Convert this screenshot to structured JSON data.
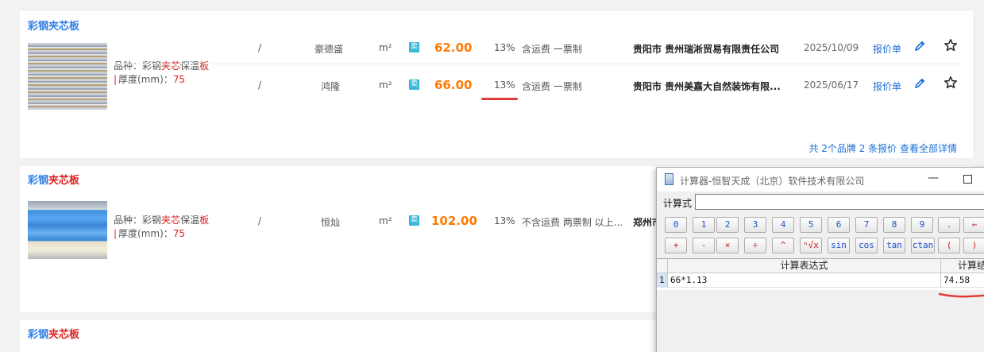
{
  "cards": [
    {
      "title_part1": "彩钢",
      "title_part2": "夹芯板",
      "spec": {
        "variety_label": "品种：",
        "variety_prefix": "彩钢",
        "variety_highlight": "夹芯",
        "variety_mid": "保温",
        "variety_suffix": "板",
        "thickness_label": "厚度(mm)：",
        "thickness_value": "75"
      },
      "rows": [
        {
          "model": "/",
          "brand": "豪德盛",
          "unit": "m²",
          "sell_badge": "卖",
          "price": "62.00",
          "tax": "13%",
          "terms": "含运费 一票制",
          "company": "贵阳市 贵州瑞淅贸易有限责任公司",
          "date": "2025/10/09",
          "quote": "报价单"
        },
        {
          "model": "/",
          "brand": "鸿隆",
          "unit": "m²",
          "sell_badge": "卖",
          "price": "66.00",
          "tax": "13%",
          "terms": "含运费 一票制",
          "company": "贵阳市 贵州美嘉大自然装饰有限...",
          "date": "2025/06/17",
          "quote": "报价单"
        }
      ],
      "summary": "共 2个品牌 2 条报价 查看全部详情"
    },
    {
      "title_part1": "彩钢",
      "title_part2": "夹芯板",
      "spec": {
        "variety_label": "品种：",
        "variety_prefix": "彩钢",
        "variety_highlight": "夹芯",
        "variety_mid": "保温",
        "variety_suffix": "板",
        "thickness_label": "厚度(mm)：",
        "thickness_value": "75"
      },
      "rows": [
        {
          "model": "/",
          "brand": "恒灿",
          "unit": "m²",
          "sell_badge": "卖",
          "price": "102.00",
          "tax": "13%",
          "terms": "不含运费 两票制 以上...",
          "company": "郑州市"
        }
      ]
    },
    {
      "title_part1": "彩钢",
      "title_part2": "夹芯板"
    }
  ],
  "calculator": {
    "title": "计算器-恒智天成（北京）软件技术有限公司",
    "minimize": "—",
    "expr_label": "计算式",
    "expr_value": "",
    "keys_row1": [
      "0",
      "1",
      "2",
      "3",
      "4",
      "5",
      "6",
      "7",
      "8",
      "9",
      ".",
      "←"
    ],
    "keys_row2": [
      "+",
      "-",
      "×",
      "÷",
      "^",
      "ⁿ√x",
      "sin",
      "cos",
      "tan",
      "ctan",
      "(",
      ")"
    ],
    "grid_header_expr": "计算表达式",
    "grid_header_result": "计算结",
    "rows": [
      {
        "index": "1",
        "expr": "66*1.13",
        "result": "74.58"
      }
    ]
  }
}
